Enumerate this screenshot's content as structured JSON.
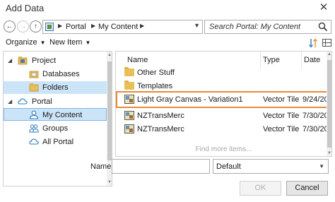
{
  "window": {
    "title": "Add Data",
    "close_glyph": "✕"
  },
  "nav": {
    "back_glyph": "←",
    "forward_glyph": "→",
    "up_glyph": "↑",
    "breadcrumb": [
      "Portal",
      "My Content"
    ],
    "search_placeholder": "Search Portal: My Content"
  },
  "toolbar": {
    "organize_label": "Organize",
    "new_item_label": "New Item"
  },
  "tree": {
    "items": [
      {
        "label": "Project",
        "expanded": true,
        "level": 0
      },
      {
        "label": "Databases",
        "level": 1
      },
      {
        "label": "Folders",
        "level": 1,
        "selected": true
      },
      {
        "label": "Portal",
        "expanded": true,
        "level": 0
      },
      {
        "label": "My Content",
        "level": 1,
        "current": true
      },
      {
        "label": "Groups",
        "level": 1
      },
      {
        "label": "All Portal",
        "level": 1
      }
    ]
  },
  "content": {
    "columns": {
      "name": "Name",
      "type": "Type",
      "date": "Date"
    },
    "rows": [
      {
        "name": "Other Stuff",
        "type": "",
        "date": "",
        "icon": "folder-icon"
      },
      {
        "name": "Templates",
        "type": "",
        "date": "",
        "icon": "folder-icon"
      },
      {
        "name": "Light Gray Canvas - Variation1",
        "type": "Vector Tile",
        "date": "9/24/20",
        "icon": "vector-tile-icon",
        "highlighted": true
      },
      {
        "name": "NZTransMerc",
        "type": "Vector Tile",
        "date": "7/30/20",
        "icon": "vector-tile-icon"
      },
      {
        "name": "NZTransMerc",
        "type": "Vector Tile",
        "date": "7/30/20",
        "icon": "vector-tile-icon"
      }
    ],
    "find_more": "Find more items..."
  },
  "footer": {
    "name_label": "Name",
    "name_value": "",
    "filter_value": "Default",
    "ok_label": "OK",
    "cancel_label": "Cancel"
  },
  "colors": {
    "highlight": "#e8893a",
    "selection": "#cce4f7"
  }
}
